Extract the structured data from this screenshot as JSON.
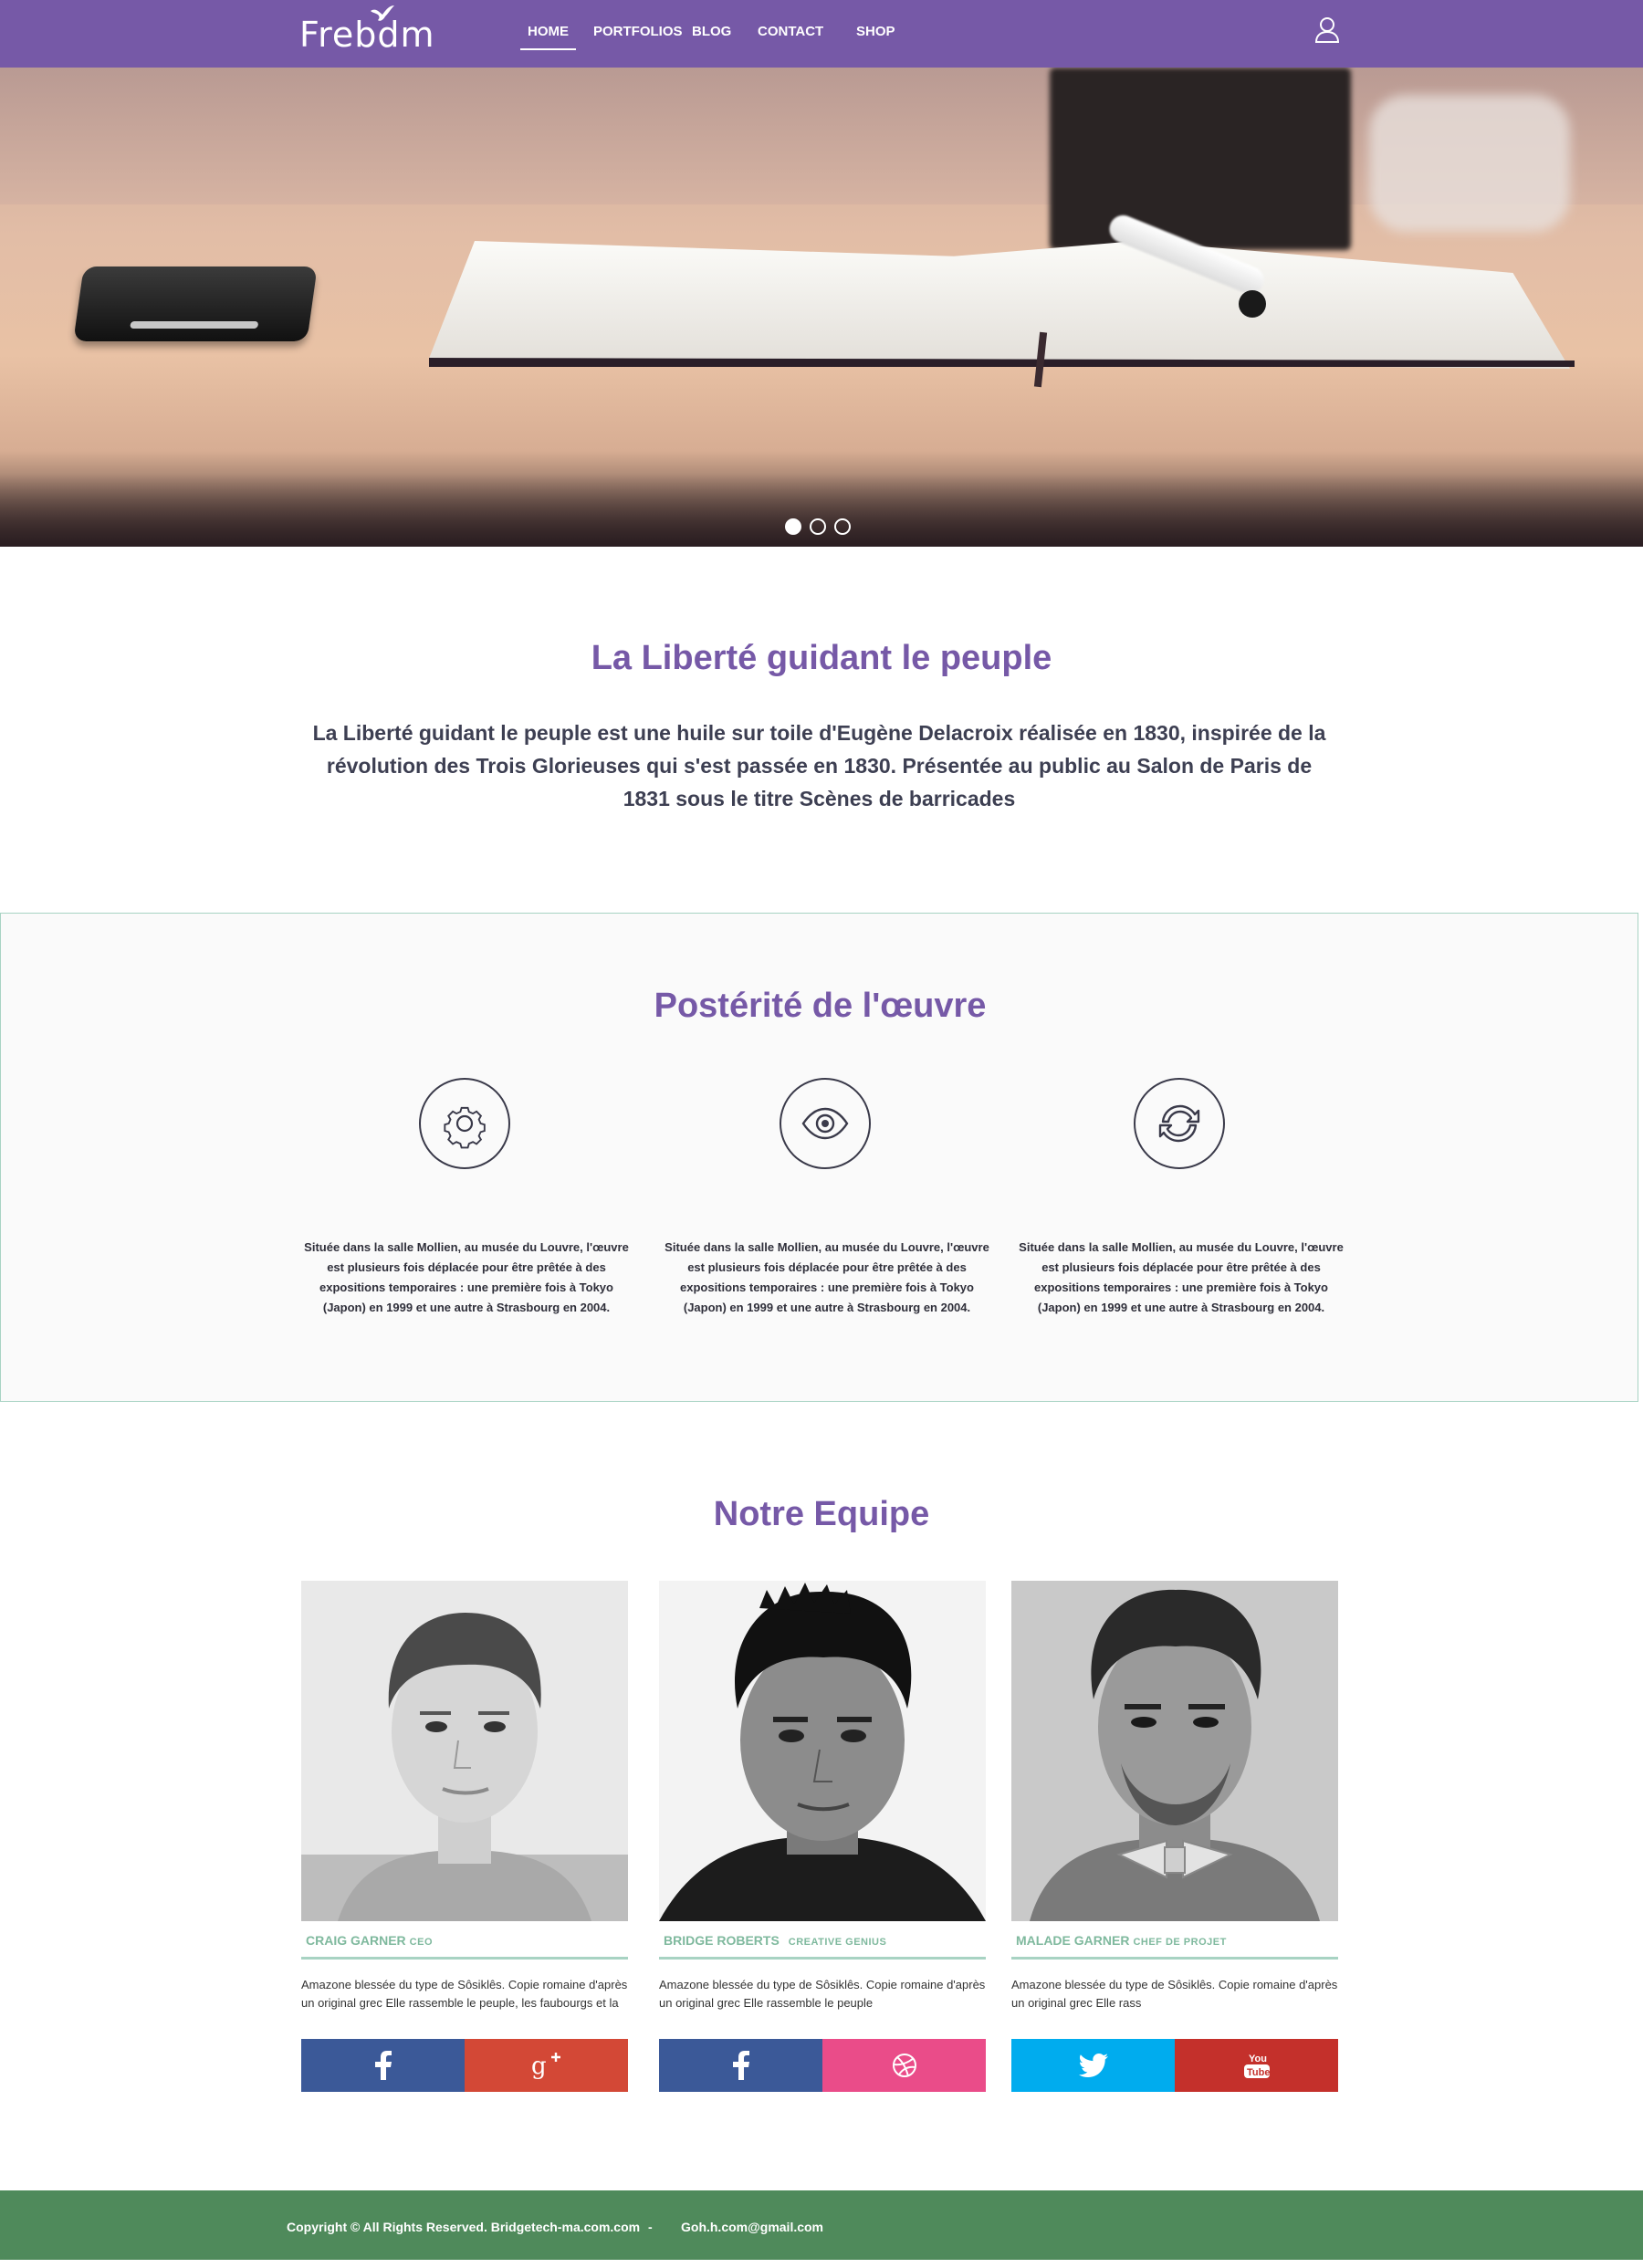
{
  "nav": {
    "logo": "Frebdm",
    "items": [
      {
        "label": "HOME",
        "active": true
      },
      {
        "label": "PORTFOLIOS"
      },
      {
        "label": "BLOG"
      },
      {
        "label": "CONTACT"
      },
      {
        "label": "SHOP"
      }
    ],
    "user_icon": "user-icon"
  },
  "hero": {
    "slides": 3,
    "active_slide": 1
  },
  "intro": {
    "title": "La Liberté guidant le peuple",
    "text": "La Liberté guidant  le peuple est une huile sur toile d'Eugène Delacroix réalisée en 1830, inspirée de la révolution des Trois Glorieuses qui s'est passée en 1830. Présentée au public au Salon de Paris de 1831 sous le titre Scènes de barricades"
  },
  "posterite": {
    "title": "Postérité de l'œuvre",
    "features": [
      {
        "icon": "gear-icon",
        "text": "Située dans la salle Mollien, au musée du Louvre, l'œuvre est plusieurs fois déplacée pour être prêtée à des expositions temporaires : une première fois à Tokyo (Japon) en 1999 et une autre à Strasbourg en 2004."
      },
      {
        "icon": "eye-icon",
        "text": "Située dans la salle Mollien, au musée du Louvre, l'œuvre est plusieurs fois déplacée pour être prêtée à des expositions temporaires : une première fois à Tokyo (Japon) en 1999 et une autre à Strasbourg en 2004."
      },
      {
        "icon": "refresh-icon",
        "text": "Située dans la salle Mollien, au musée du Louvre, l'œuvre est plusieurs fois déplacée pour être prêtée à des expositions temporaires : une première fois à Tokyo (Japon) en 1999 et une autre à Strasbourg en 2004."
      }
    ]
  },
  "team": {
    "title": "Notre Equipe",
    "members": [
      {
        "name": "CRAIG GARNER",
        "role": "CEO",
        "desc": "Amazone blessée du type de Sôsiklês. Copie romaine d'après un original grec Elle rassemble le peuple, les faubourgs et la",
        "social": [
          {
            "icon": "facebook-icon",
            "color": "#3b5998"
          },
          {
            "icon": "google-plus-icon",
            "color": "#d34836"
          }
        ]
      },
      {
        "name": "BRIDGE ROBERTS",
        "role": "CREATIVE GENIUS",
        "desc": "Amazone blessée du type de Sôsiklês. Copie romaine d'après un original grec Elle rassemble le peuple",
        "social": [
          {
            "icon": "facebook-icon",
            "color": "#3b5998"
          },
          {
            "icon": "dribbble-icon",
            "color": "#ea4c89"
          }
        ]
      },
      {
        "name": "MALADE GARNER",
        "role": "CHEF DE PROJET",
        "desc": "Amazone blessée du type de Sôsiklês. Copie romaine d'après un original grec Elle rass",
        "social": [
          {
            "icon": "twitter-icon",
            "color": "#00acee"
          },
          {
            "icon": "youtube-icon",
            "color": "#c4302b"
          }
        ]
      }
    ]
  },
  "footer": {
    "copyright": "Copyright © All Rights Reserved. Bridgetech-ma.com.com",
    "separator": "-",
    "email": "Goh.h.com@gmail.com"
  },
  "colors": {
    "brand": "#7659a7",
    "accent": "#a8d3c3",
    "footer": "#4f8a5b"
  }
}
